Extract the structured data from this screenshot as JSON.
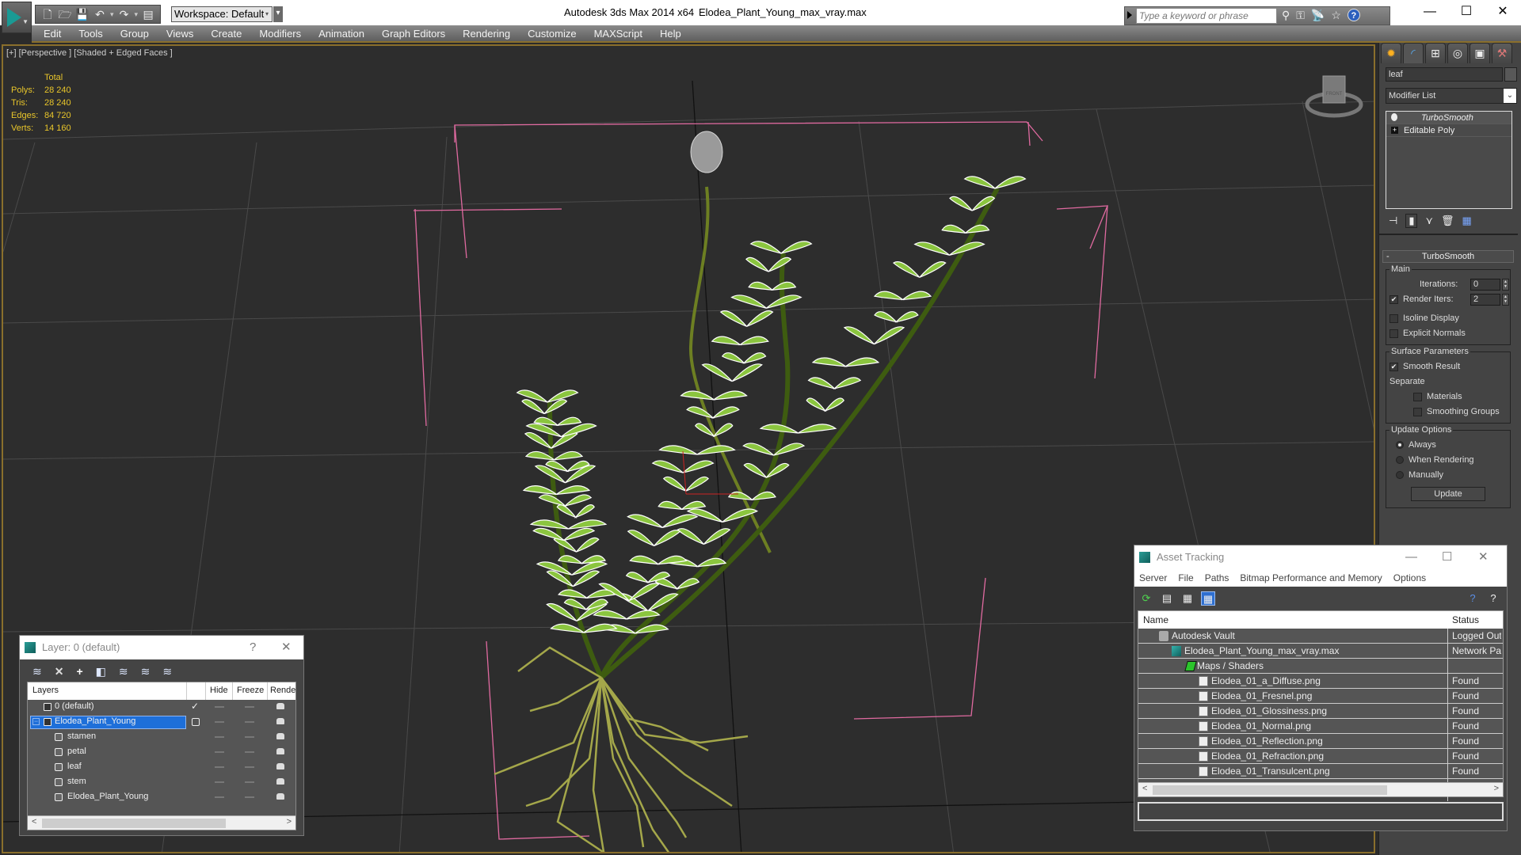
{
  "titlebar": {
    "app_title": "Autodesk 3ds Max  2014 x64",
    "document_title": "Elodea_Plant_Young_max_vray.max",
    "workspace": "Workspace: Default",
    "search_placeholder": "Type a keyword or phrase",
    "window_controls": {
      "minimize": "—",
      "maximize": "☐",
      "close": "✕"
    }
  },
  "menubar": {
    "items": [
      "Edit",
      "Tools",
      "Group",
      "Views",
      "Create",
      "Modifiers",
      "Animation",
      "Graph Editors",
      "Rendering",
      "Customize",
      "MAXScript",
      "Help"
    ]
  },
  "viewport": {
    "label": "[+] [Perspective ] [Shaded + Edged Faces ]",
    "stats": {
      "header": "Total",
      "rows": [
        {
          "key": "Polys:",
          "value": "28 240"
        },
        {
          "key": "Tris:",
          "value": "28 240"
        },
        {
          "key": "Edges:",
          "value": "84 720"
        },
        {
          "key": "Verts:",
          "value": "14 160"
        }
      ]
    },
    "viewcube_face": "FRONT"
  },
  "command_panel": {
    "object_name": "leaf",
    "modifier_list": "Modifier List",
    "stack": [
      {
        "label": "TurboSmooth",
        "selected": true
      },
      {
        "label": "Editable Poly",
        "selected": false
      }
    ],
    "rollout": {
      "title": "TurboSmooth",
      "main": {
        "title": "Main",
        "iterations_label": "Iterations:",
        "iterations_value": "0",
        "render_iters_label": "Render Iters:",
        "render_iters_value": "2",
        "render_iters_checked": true,
        "isoline_label": "Isoline Display",
        "explicit_normals_label": "Explicit Normals"
      },
      "surface": {
        "title": "Surface Parameters",
        "smooth_result_label": "Smooth Result",
        "separate_label": "Separate",
        "materials_label": "Materials",
        "smoothing_groups_label": "Smoothing Groups"
      },
      "update": {
        "title": "Update Options",
        "options": [
          "Always",
          "When Rendering",
          "Manually"
        ],
        "selected": "Always",
        "button": "Update"
      }
    }
  },
  "layer_window": {
    "title": "Layer: 0 (default)",
    "help": "?",
    "close": "✕",
    "columns": [
      "Layers",
      "Hide",
      "Freeze",
      "Rende"
    ],
    "rows": [
      {
        "name": "0 (default)",
        "level": 0,
        "current": true
      },
      {
        "name": "Elodea_Plant_Young",
        "level": 0,
        "selected": true
      },
      {
        "name": "stamen",
        "level": 1
      },
      {
        "name": "petal",
        "level": 1
      },
      {
        "name": "leaf",
        "level": 1
      },
      {
        "name": "stem",
        "level": 1
      },
      {
        "name": "Elodea_Plant_Young",
        "level": 1
      }
    ]
  },
  "asset_tracking": {
    "title": "Asset Tracking",
    "menu": [
      "Server",
      "File",
      "Paths",
      "Bitmap Performance and Memory",
      "Options"
    ],
    "columns": [
      "Name",
      "Status"
    ],
    "rows": [
      {
        "name": "Autodesk Vault",
        "status": "Logged Out",
        "type": "vault",
        "level": 1
      },
      {
        "name": "Elodea_Plant_Young_max_vray.max",
        "status": "Network Path",
        "type": "max",
        "level": 2
      },
      {
        "name": "Maps / Shaders",
        "status": "",
        "type": "maps",
        "level": 3
      },
      {
        "name": "Elodea_01_a_Diffuse.png",
        "status": "Found",
        "type": "png",
        "level": 4
      },
      {
        "name": "Elodea_01_Fresnel.png",
        "status": "Found",
        "type": "png",
        "level": 4
      },
      {
        "name": "Elodea_01_Glossiness.png",
        "status": "Found",
        "type": "png",
        "level": 4
      },
      {
        "name": "Elodea_01_Normal.png",
        "status": "Found",
        "type": "png",
        "level": 4
      },
      {
        "name": "Elodea_01_Reflection.png",
        "status": "Found",
        "type": "png",
        "level": 4
      },
      {
        "name": "Elodea_01_Refraction.png",
        "status": "Found",
        "type": "png",
        "level": 4
      },
      {
        "name": "Elodea_01_Transulcent.png",
        "status": "Found",
        "type": "png",
        "level": 4
      }
    ]
  },
  "colors": {
    "viewport_border": "#8a6f2c",
    "stats_text": "#e8c52a",
    "leaf_green": "#8bc53f",
    "selection_blue": "#1e6fd9",
    "bbox_pink": "#e06aa0"
  }
}
